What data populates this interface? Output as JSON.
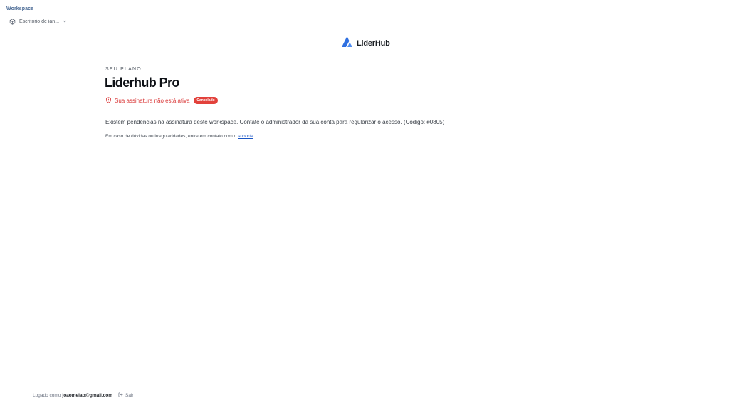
{
  "sidebar": {
    "workspace_label": "Workspace",
    "workspace_selected": "Escritorio de ian...",
    "icons": {
      "workspace": "box-icon",
      "dropdown": "chevron-down-icon"
    }
  },
  "brand": {
    "name": "LiderHub",
    "icon": "liderhub-logo-icon",
    "colors": {
      "primary": "#2f6fe0",
      "secondary": "#4d8bf0"
    }
  },
  "plan": {
    "kicker": "SEU PLANO",
    "title": "Liderhub Pro",
    "status_text": "Sua assinatura não está ativa",
    "status_icon": "shield-alert-icon",
    "status_badge": "Cancelado",
    "message": "Existem pendências na assinatura deste workspace. Contate o administrador da sua conta para regularizar o acesso. (Código: #0805)",
    "help_prefix": "Em caso de dúvidas ou irregularidades, entre em contato com o ",
    "help_link": "suporte",
    "help_suffix": ".",
    "colors": {
      "danger": "#d93434",
      "badge": "#e2413b",
      "link": "#1a55c4"
    }
  },
  "footer": {
    "logged_prefix": "Logado como",
    "email": "joaomelao@gmail.com",
    "logout_label": "Sair",
    "logout_icon": "logout-icon"
  }
}
